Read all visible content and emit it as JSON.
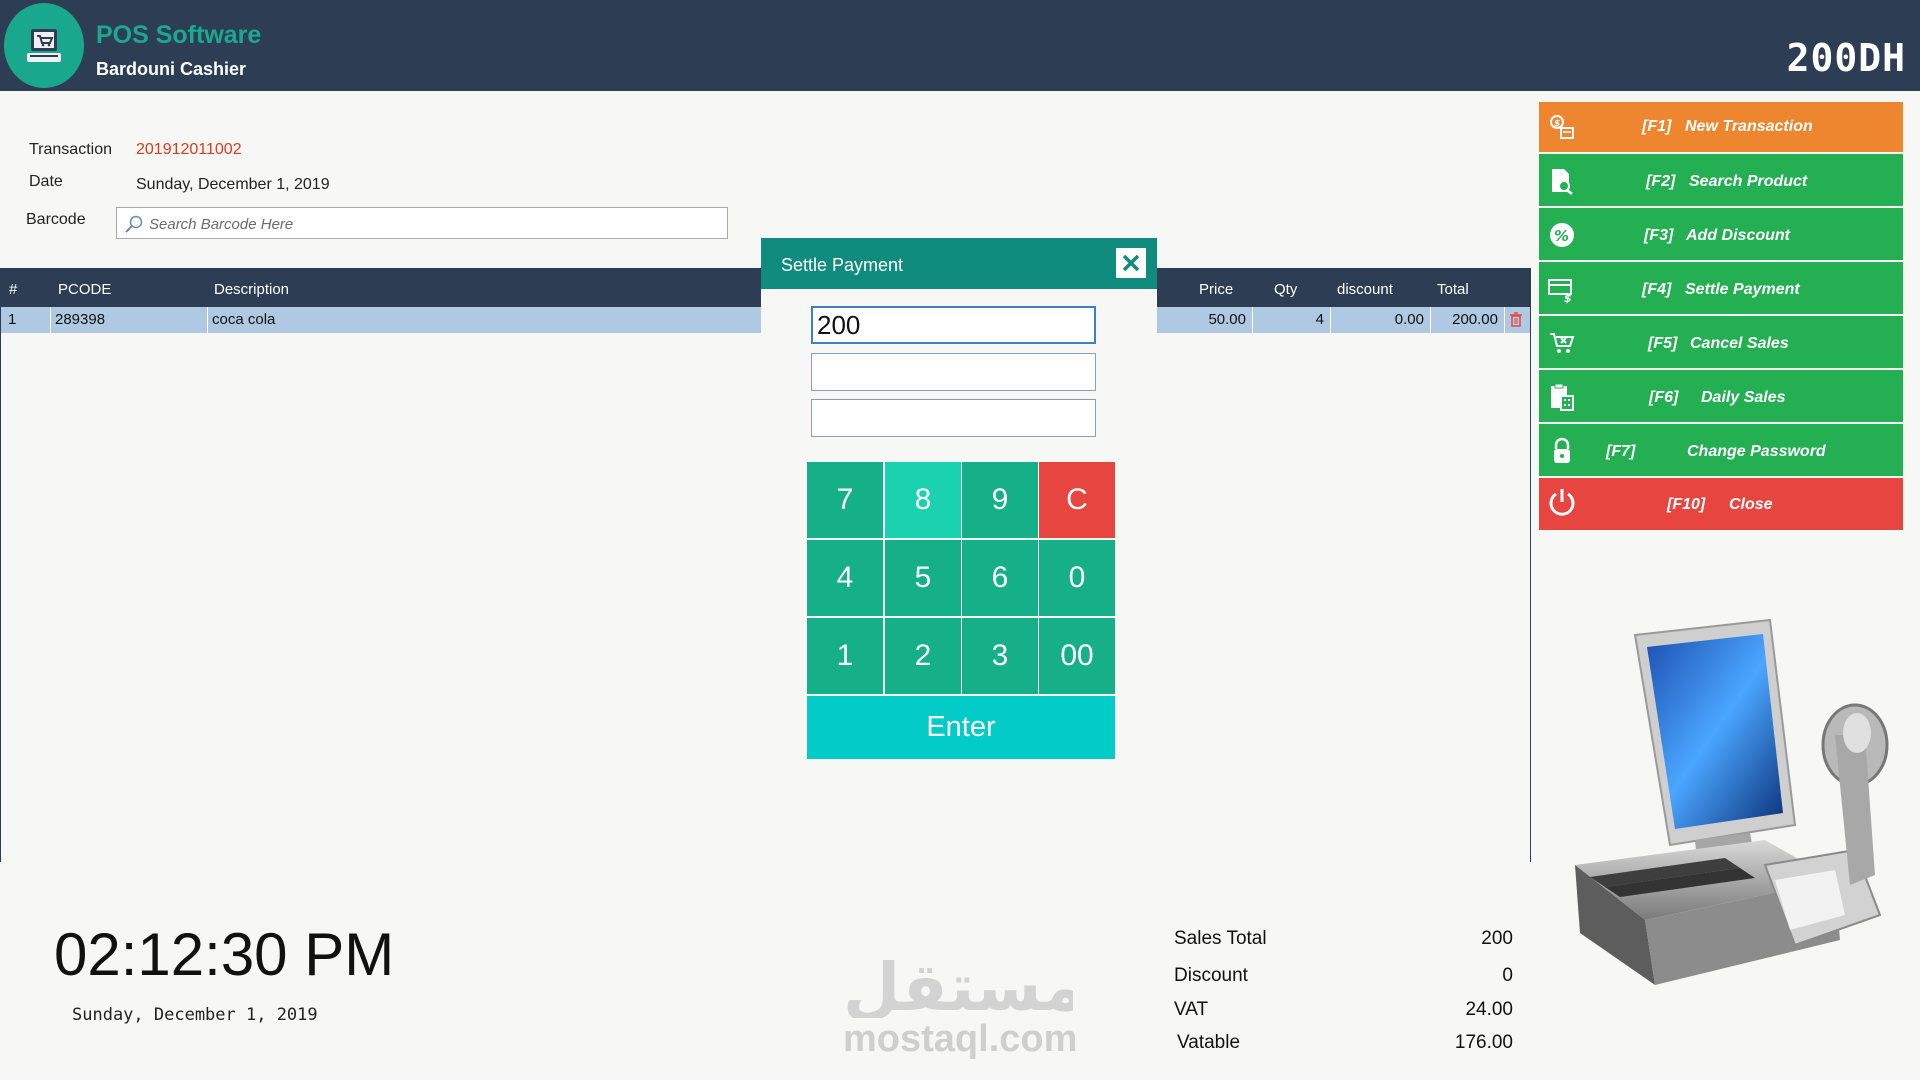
{
  "header": {
    "app_title": "POS Software",
    "app_subtitle": "Bardouni Cashier",
    "amount_display": "200DH",
    "logo_icon": "cashier-cart-icon"
  },
  "transaction": {
    "transaction_label": "Transaction",
    "transaction_no": "201912011002",
    "date_label": "Date",
    "date_value": "Sunday, December 1, 2019",
    "barcode_label": "Barcode",
    "barcode_placeholder": "Search Barcode Here",
    "barcode_value": ""
  },
  "table": {
    "columns": [
      "#",
      "PCODE",
      "Description",
      "Price",
      "Qty",
      "discount",
      "Total"
    ],
    "rows": [
      {
        "num": "1",
        "pcode": "289398",
        "description": "coca cola",
        "price": "50.00",
        "qty": "4",
        "discount": "0.00",
        "total": "200.00"
      }
    ]
  },
  "actions": [
    {
      "key": "[F1]",
      "label": "New Transaction",
      "icon": "new-transaction-icon",
      "color": "#ee8630"
    },
    {
      "key": "[F2]",
      "label": "Search Product",
      "icon": "search-product-icon",
      "color": "#24b052"
    },
    {
      "key": "[F3]",
      "label": "Add Discount",
      "icon": "discount-icon",
      "color": "#24b052"
    },
    {
      "key": "[F4]",
      "label": "Settle Payment",
      "icon": "payment-icon",
      "color": "#24b052"
    },
    {
      "key": "[F5]",
      "label": "Cancel Sales",
      "icon": "cart-cancel-icon",
      "color": "#24b052"
    },
    {
      "key": "[F6]",
      "label": "Daily Sales",
      "icon": "daily-sales-icon",
      "color": "#24b052"
    },
    {
      "key": "[F7]",
      "label": "Change Password",
      "icon": "lock-icon",
      "color": "#24b052"
    },
    {
      "key": "[F10]",
      "label": "Close",
      "icon": "power-icon",
      "color": "#e7453f"
    }
  ],
  "clock": {
    "time": "02:12:30 PM",
    "date": "Sunday, December 1, 2019"
  },
  "watermark": {
    "arabic": "مستقل",
    "latin": "mostaql.com"
  },
  "summary": {
    "sales_total_label": "Sales Total",
    "sales_total": "200",
    "discount_label": "Discount",
    "discount": "0",
    "vat_label": "VAT",
    "vat": "24.00",
    "vatable_label": "Vatable",
    "vatable": "176.00"
  },
  "dialog": {
    "title": "Settle Payment",
    "input_1": "200",
    "input_2": "",
    "input_3": "",
    "keys": [
      "7",
      "8",
      "9",
      "C",
      "4",
      "5",
      "6",
      "0",
      "1",
      "2",
      "3",
      "00"
    ],
    "enter_label": "Enter"
  },
  "colors": {
    "header_bg": "#2d3e54",
    "brand_teal": "#1aa88f",
    "action_green": "#24b052",
    "action_orange": "#ee8630",
    "action_red": "#e7453f",
    "keypad_teal": "#15af88",
    "enter_cyan": "#03cbc8",
    "transaction_red": "#d43d1d"
  }
}
